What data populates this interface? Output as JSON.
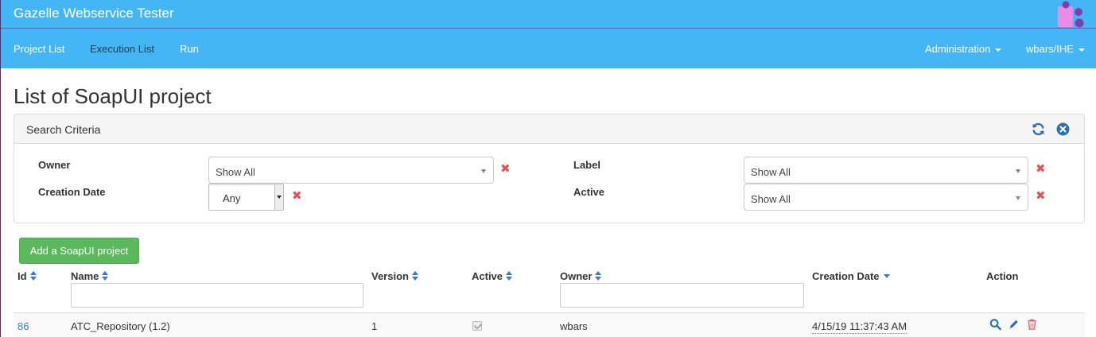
{
  "app": {
    "title": "Gazelle Webservice Tester"
  },
  "nav": {
    "items": [
      "Project List",
      "Execution List",
      "Run"
    ],
    "admin": "Administration",
    "user": "wbars/IHE"
  },
  "page": {
    "title": "List of SoapUI project"
  },
  "search": {
    "title": "Search Criteria",
    "owner_label": "Owner",
    "owner_value": "Show All",
    "creation_label": "Creation Date",
    "creation_value": "Any",
    "label_label": "Label",
    "label_value": "Show All",
    "active_label": "Active",
    "active_value": "Show All"
  },
  "actions": {
    "add_label": "Add a SoapUI project"
  },
  "table": {
    "headers": {
      "id": "Id",
      "name": "Name",
      "version": "Version",
      "active": "Active",
      "owner": "Owner",
      "creation_date": "Creation Date",
      "action": "Action"
    },
    "rows": [
      {
        "id": "86",
        "name": "ATC_Repository (1.2)",
        "version": "1",
        "active": true,
        "owner": "wbars",
        "creation_date": "4/15/19 11:37:43 AM"
      }
    ]
  },
  "colors": {
    "topbar": "#45b6f5",
    "primary": "#3a7cc0",
    "success": "#5cb85c",
    "danger": "#e05555"
  }
}
